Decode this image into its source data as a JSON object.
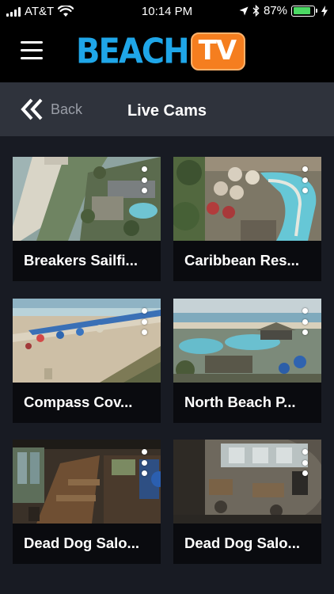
{
  "status_bar": {
    "carrier": "AT&T",
    "time": "10:14 PM",
    "battery": "87%",
    "battery_level": 0.87,
    "battery_color": "#4cd964",
    "icons": [
      "signal-bars-icon",
      "wifi-icon",
      "location-arrow-icon",
      "bluetooth-icon",
      "battery-icon",
      "charging-bolt-icon"
    ]
  },
  "header": {
    "menu_icon": "hamburger-menu-icon",
    "logo_text": "BEACH",
    "logo_badge": "TV",
    "logo_color": "#1fa6e8",
    "badge_color": "#f57e1f"
  },
  "nav": {
    "back_icon": "double-chevron-left-icon",
    "back_label": "Back",
    "title": "Live Cams"
  },
  "cams": [
    {
      "title": "Breakers Sailfi...",
      "scene": "beach-aerial"
    },
    {
      "title": "Caribbean Res...",
      "scene": "pool-lazy-river"
    },
    {
      "title": "Compass Cov...",
      "scene": "beach-umbrellas"
    },
    {
      "title": "North Beach P...",
      "scene": "resort-pools"
    },
    {
      "title": "Dead Dog Salo...",
      "scene": "bar-interior"
    },
    {
      "title": "Dead Dog Salo...",
      "scene": "bar-interior-wide"
    }
  ]
}
